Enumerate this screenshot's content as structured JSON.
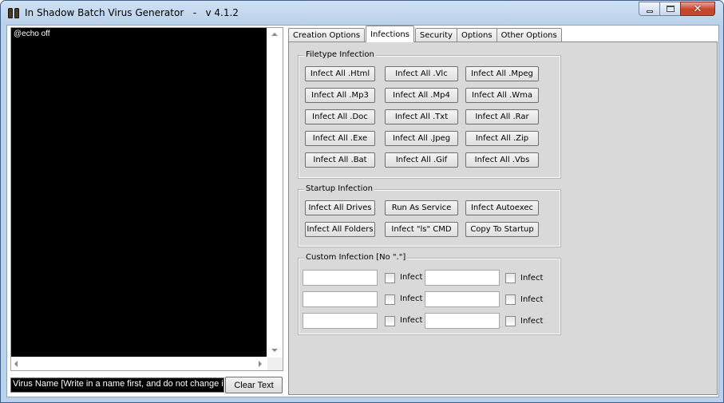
{
  "window": {
    "title": "In Shadow Batch Virus Generator   -   v 4.1.2",
    "minimize_label": "",
    "close_label": "✕"
  },
  "editor": {
    "content": "@echo off"
  },
  "virus_name": {
    "value": "Virus Name [Write in a name first, and do not change it]"
  },
  "clear_button": "Clear Text",
  "tabs": [
    {
      "label": "Creation Options",
      "active": false
    },
    {
      "label": "Infections",
      "active": true
    },
    {
      "label": "Security",
      "active": false
    },
    {
      "label": "Options",
      "active": false
    },
    {
      "label": "Other Options",
      "active": false
    }
  ],
  "filetype_infection": {
    "legend": "Filetype Infection",
    "buttons": [
      "Infect All .Html",
      "Infect All .Vlc",
      "Infect All .Mpeg",
      "Infect All .Mp3",
      "Infect All .Mp4",
      "Infect All .Wma",
      "Infect All .Doc",
      "Infect All .Txt",
      "Infect All .Rar",
      "Infect All .Exe",
      "Infect All .Jpeg",
      "Infect All .Zip",
      "Infect All .Bat",
      "Infect All .Gif",
      "Infect All .Vbs"
    ]
  },
  "startup_infection": {
    "legend": "Startup Infection",
    "buttons": [
      "Infect All Drives",
      "Run As Service",
      "Infect Autoexec",
      "Infect All Folders",
      "Infect \"ls\" CMD",
      "Copy To Startup"
    ]
  },
  "custom_infection": {
    "legend": "Custom Infection [No \".\"]",
    "infect_label": "Infect",
    "rows": [
      {
        "left_value": "",
        "left_checked": false,
        "right_value": "",
        "right_checked": false
      },
      {
        "left_value": "",
        "left_checked": false,
        "right_value": "",
        "right_checked": false
      },
      {
        "left_value": "",
        "left_checked": false,
        "right_value": "",
        "right_checked": false
      }
    ]
  }
}
